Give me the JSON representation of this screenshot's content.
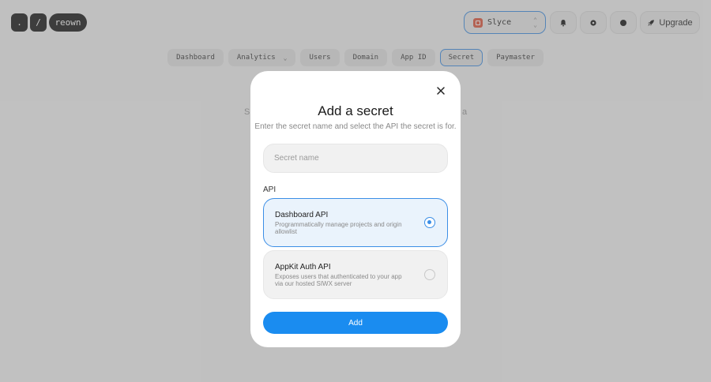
{
  "brand": {
    "mark1": ".",
    "mark2": "/",
    "wordmark": "reown"
  },
  "header": {
    "project_name": "Slyce",
    "upgrade_label": "Upgrade",
    "project_color": "#e0553b"
  },
  "tabs": [
    {
      "label": "Dashboard"
    },
    {
      "label": "Analytics",
      "has_dropdown": true
    },
    {
      "label": "Users"
    },
    {
      "label": "Domain"
    },
    {
      "label": "App ID"
    },
    {
      "label": "Secret",
      "active": true
    },
    {
      "label": "Paymaster"
    }
  ],
  "background_text": {
    "left": "S",
    "right": "a"
  },
  "modal": {
    "title": "Add a secret",
    "subtitle": "Enter the secret name and select the API the secret is for.",
    "secret_name_value": "",
    "secret_name_placeholder": "Secret name",
    "api_label": "API",
    "options": [
      {
        "title": "Dashboard API",
        "description": "Programmatically manage projects and origin allowlist",
        "selected": true
      },
      {
        "title": "AppKit Auth API",
        "description": "Exposes users that authenticated to your app via our hosted SIWX server",
        "selected": false
      }
    ],
    "add_label": "Add"
  },
  "colors": {
    "accent": "#1a8cf0",
    "selected_border": "#3b8ee6",
    "overlay": "rgba(120,120,120,0.42)"
  }
}
